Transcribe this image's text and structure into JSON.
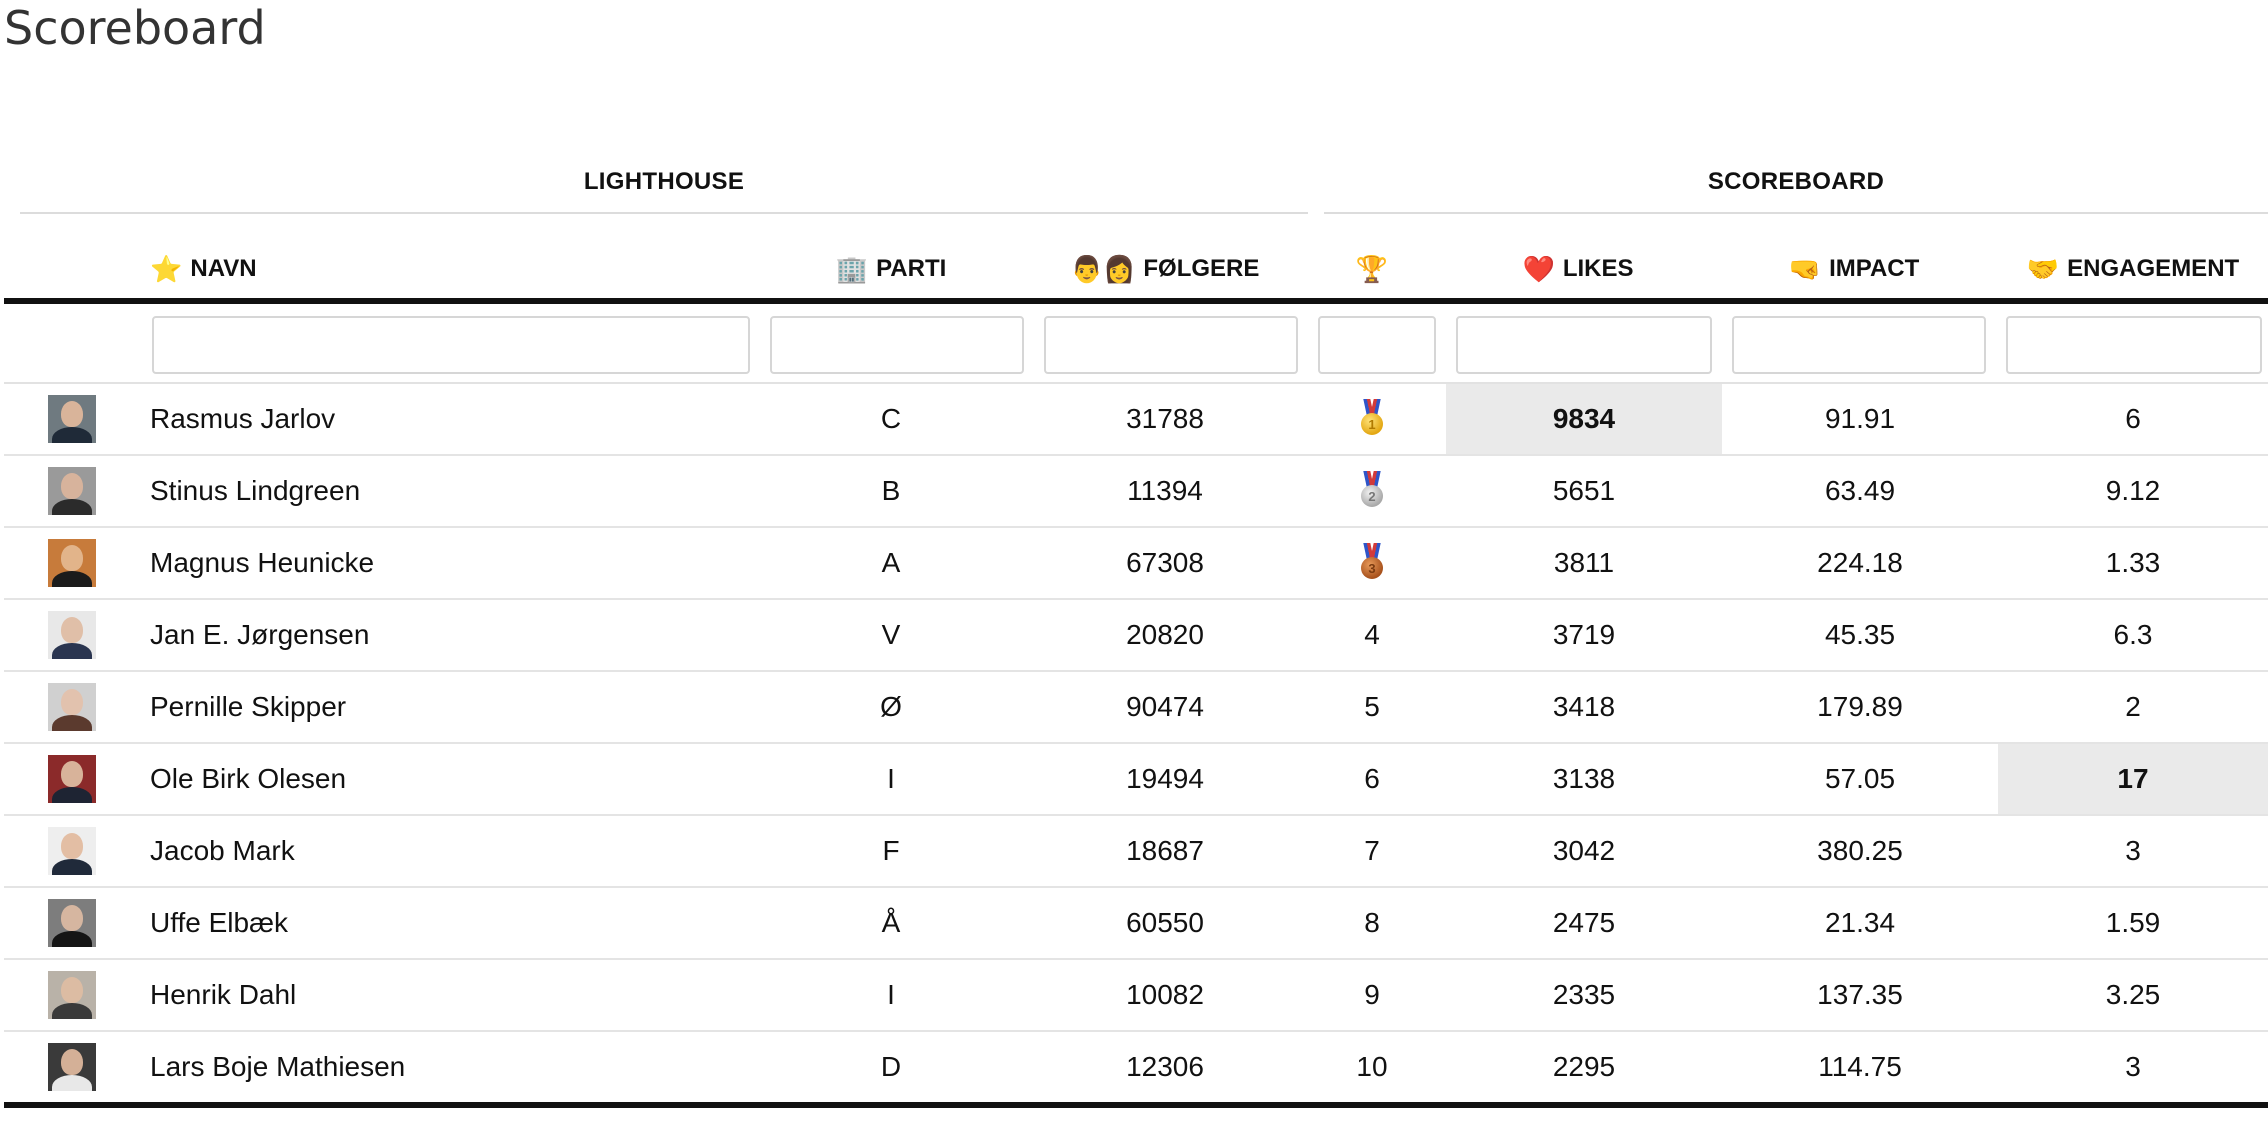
{
  "page_title": "Scoreboard",
  "groups": [
    {
      "label": "LIGHTHOUSE"
    },
    {
      "label": "SCOREBOARD"
    }
  ],
  "columns": {
    "navn": {
      "icon": "⭐",
      "label": "NAVN"
    },
    "parti": {
      "icon": "🏢",
      "label": "PARTI"
    },
    "folgere": {
      "icon": "👨👩",
      "label": "FØLGERE"
    },
    "rank": {
      "icon": "🏆",
      "label": ""
    },
    "likes": {
      "icon": "❤️",
      "label": "LIKES"
    },
    "impact": {
      "icon": "🤜",
      "label": "IMPACT"
    },
    "engagement": {
      "icon": "🤝",
      "label": "ENGAGEMENT"
    }
  },
  "filters": {
    "navn": "",
    "parti": "",
    "folgere": "",
    "rank": "",
    "likes": "",
    "impact": "",
    "engagement": ""
  },
  "rows": [
    {
      "name": "Rasmus Jarlov",
      "parti": "C",
      "folgere": "31788",
      "rank": "1",
      "medal": "gold",
      "likes": "9834",
      "impact": "91.91",
      "engagement": "6",
      "avatar_colors": {
        "bg": "#6f7a80",
        "skin": "#d9b49a",
        "shirt": "#1f2a38"
      }
    },
    {
      "name": "Stinus Lindgreen",
      "parti": "B",
      "folgere": "11394",
      "rank": "2",
      "medal": "silver",
      "likes": "5651",
      "impact": "63.49",
      "engagement": "9.12",
      "avatar_colors": {
        "bg": "#9a9a9a",
        "skin": "#d7b39c",
        "shirt": "#2b2b2b"
      }
    },
    {
      "name": "Magnus Heunicke",
      "parti": "A",
      "folgere": "67308",
      "rank": "3",
      "medal": "bronze",
      "likes": "3811",
      "impact": "224.18",
      "engagement": "1.33",
      "avatar_colors": {
        "bg": "#c77b3b",
        "skin": "#e2b48a",
        "shirt": "#1b1b1b"
      }
    },
    {
      "name": "Jan E. Jørgensen",
      "parti": "V",
      "folgere": "20820",
      "rank": "4",
      "medal": "",
      "likes": "3719",
      "impact": "45.35",
      "engagement": "6.3",
      "avatar_colors": {
        "bg": "#e8e8e8",
        "skin": "#e0bfa8",
        "shirt": "#2a3550"
      }
    },
    {
      "name": "Pernille Skipper",
      "parti": "Ø",
      "folgere": "90474",
      "rank": "5",
      "medal": "",
      "likes": "3418",
      "impact": "179.89",
      "engagement": "2",
      "avatar_colors": {
        "bg": "#d0d0d0",
        "skin": "#e2c2ae",
        "shirt": "#5b3a2e"
      }
    },
    {
      "name": "Ole Birk Olesen",
      "parti": "I",
      "folgere": "19494",
      "rank": "6",
      "medal": "",
      "likes": "3138",
      "impact": "57.05",
      "engagement": "17",
      "avatar_colors": {
        "bg": "#8b2a2a",
        "skin": "#d8b39a",
        "shirt": "#1e2433"
      }
    },
    {
      "name": "Jacob Mark",
      "parti": "F",
      "folgere": "18687",
      "rank": "7",
      "medal": "",
      "likes": "3042",
      "impact": "380.25",
      "engagement": "3",
      "avatar_colors": {
        "bg": "#eeeeee",
        "skin": "#e3bea4",
        "shirt": "#202a3a"
      }
    },
    {
      "name": "Uffe Elbæk",
      "parti": "Å",
      "folgere": "60550",
      "rank": "8",
      "medal": "",
      "likes": "2475",
      "impact": "21.34",
      "engagement": "1.59",
      "avatar_colors": {
        "bg": "#7d7d7d",
        "skin": "#d6b6a0",
        "shirt": "#151515"
      }
    },
    {
      "name": "Henrik Dahl",
      "parti": "I",
      "folgere": "10082",
      "rank": "9",
      "medal": "",
      "likes": "2335",
      "impact": "137.35",
      "engagement": "3.25",
      "avatar_colors": {
        "bg": "#b9b2a8",
        "skin": "#dcbca3",
        "shirt": "#3a3a3a"
      }
    },
    {
      "name": "Lars Boje Mathiesen",
      "parti": "D",
      "folgere": "12306",
      "rank": "10",
      "medal": "",
      "likes": "2295",
      "impact": "114.75",
      "engagement": "3",
      "avatar_colors": {
        "bg": "#3a3a3a",
        "skin": "#d4b097",
        "shirt": "#e8e8e8"
      }
    }
  ],
  "highlights": {
    "likes_row": 0,
    "engagement_row": 5,
    "color": "#eaeaea"
  }
}
